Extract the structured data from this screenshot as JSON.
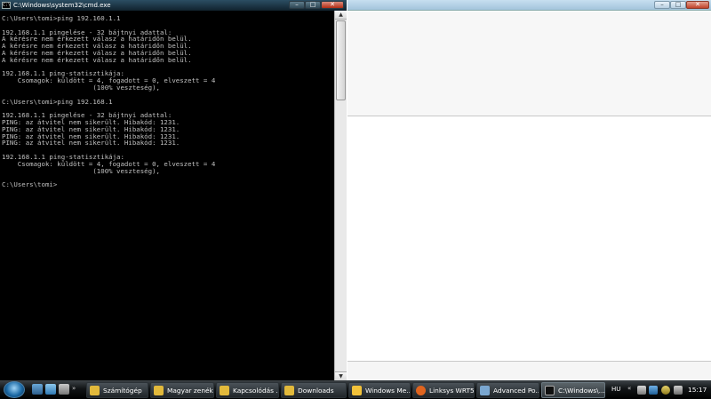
{
  "cmd": {
    "title": "C:\\Windows\\system32\\cmd.exe",
    "icon": "cmd-icon",
    "buttons": {
      "minimize": "–",
      "maximize": "□",
      "close": "✕"
    },
    "output": "C:\\Users\\tomi>ping 192.160.1.1\n\n192.168.1.1 pingelése - 32 bájtnyi adattal:\nA kérésre nem érkezett válasz a határidőn belül.\nA kérésre nem érkezett válasz a határidőn belül.\nA kérésre nem érkezett válasz a határidőn belül.\nA kérésre nem érkezett válasz a határidőn belül.\n\n192.168.1.1 ping-statisztikája:\n    Csomagok: küldött = 4, fogadott = 0, elveszett = 4\n                       (100% veszteség),\n\nC:\\Users\\tomi>ping 192.168.1\n\n192.168.1.1 pingelése - 32 bájtnyi adattal:\nPING: az átvitel nem sikerült. Hibakód: 1231.\nPING: az átvitel nem sikerült. Hibakód: 1231.\nPING: az átvitel nem sikerült. Hibakód: 1231.\nPING: az átvitel nem sikerült. Hibakód: 1231.\n\n192.168.1.1 ping-statisztikája:\n    Csomagok: küldött = 4, fogadott = 0, elveszett = 4\n                       (100% veszteség),\n\nC:\\Users\\tomi>",
    "scrollbar": {
      "up": "▲",
      "down": "▼"
    }
  },
  "app": {
    "buttons": {
      "minimize": "–",
      "maximize": "□",
      "close": "✕"
    }
  },
  "taskbar": {
    "quicklaunch_arrow": "»",
    "items": [
      {
        "label": "Számítógép",
        "icon": "computer-icon",
        "color": "#e2b93b"
      },
      {
        "label": "Magyar zenék",
        "icon": "folder-icon",
        "color": "#e2b93b"
      },
      {
        "label": "Kapcsolódás ...",
        "icon": "folder-icon",
        "color": "#e2b93b"
      },
      {
        "label": "Downloads",
        "icon": "folder-icon",
        "color": "#e2b93b"
      },
      {
        "label": "Windows Me...",
        "icon": "media-player-icon",
        "color": "#f2c23a"
      },
      {
        "label": "Linksys WRT5...",
        "icon": "firefox-icon",
        "color": "#e0641e"
      },
      {
        "label": "Advanced Po...",
        "icon": "app-icon",
        "color": "#7aa7d0"
      },
      {
        "label": "C:\\Windows\\...",
        "icon": "cmd-icon",
        "color": "#111111"
      }
    ],
    "tray": {
      "language": "HU",
      "chevron": "«",
      "clock": "15:17"
    }
  }
}
